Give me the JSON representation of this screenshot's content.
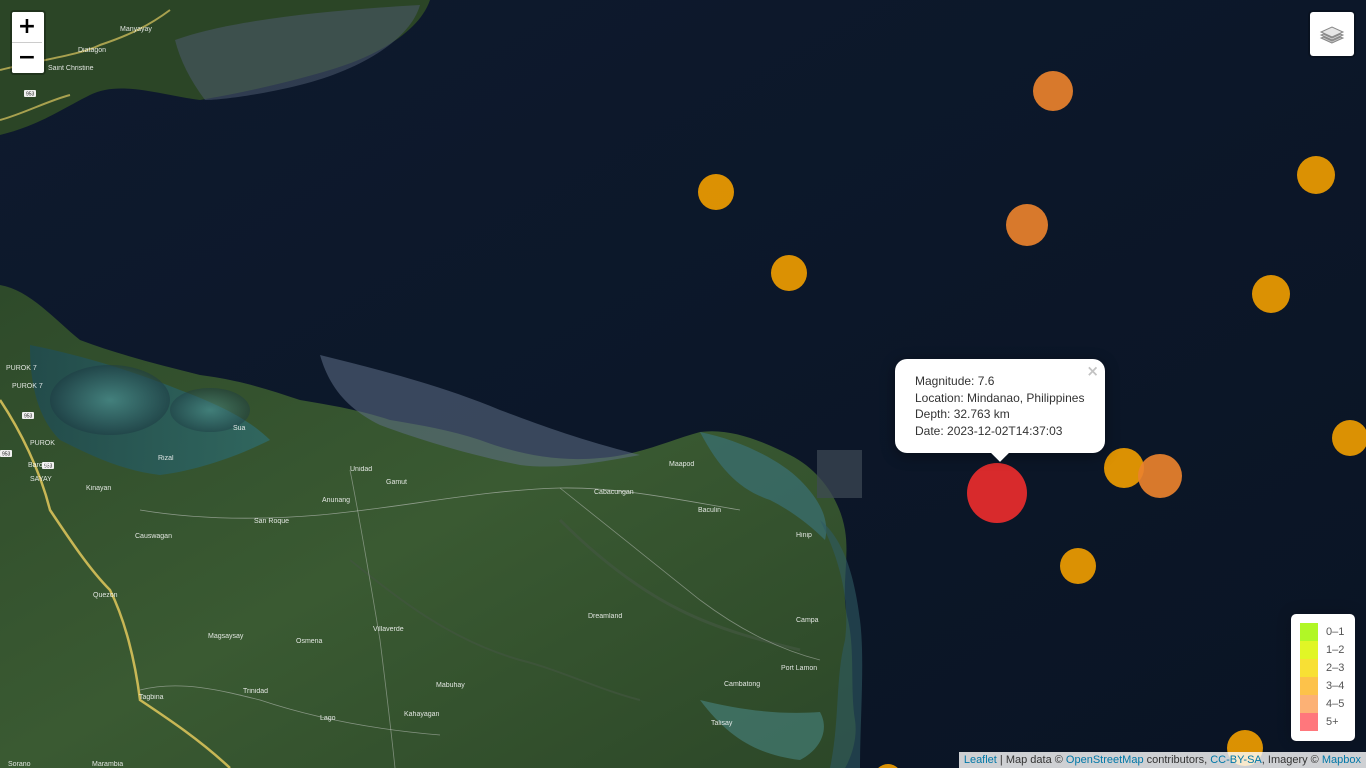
{
  "zoom": {
    "in_label": "+",
    "out_label": "−"
  },
  "layers": {
    "icon": "layers-icon"
  },
  "places": {
    "manyayay": "Manyayay",
    "diatagon": "Diatagon",
    "saint_christine": "Saint Christine",
    "barobo": "Barobo",
    "kinayan": "Kinayan",
    "rizal": "Rizal",
    "sua": "Sua",
    "unidad": "Unidad",
    "gamut": "Gamut",
    "anunang": "Anunang",
    "san_roque": "San Roque",
    "causwagan": "Causwagan",
    "cabacungan": "Cabacungan",
    "maapod": "Maapod",
    "baculin": "Baculin",
    "hinip": "Hinip",
    "quezon": "Quezon",
    "dreamland": "Dreamland",
    "villaverde": "Villaverde",
    "magsaysay": "Magsaysay",
    "osmena": "Osmena",
    "campa": "Campa",
    "port_lamon": "Port Lamon",
    "cambatong": "Cambatong",
    "tagbina": "Tagbina",
    "trinidad": "Trinidad",
    "mabuhay": "Mabuhay",
    "lago": "Lago",
    "kahayagan": "Kahayagan",
    "talisay": "Talisay",
    "sayay": "SAYAY",
    "purok7a": "PUROK 7",
    "purok7b": "PUROK 7",
    "purok": "PUROK",
    "sorano": "Sorano",
    "marambia": "Marambia"
  },
  "road_shields": [
    "953",
    "953",
    "953",
    "953"
  ],
  "earthquakes": [
    {
      "magnitude": 4.2,
      "color": "#ea822c",
      "label": "quake-1"
    },
    {
      "magnitude": 3.4,
      "color": "#ee9c00",
      "label": "quake-2"
    },
    {
      "magnitude": 4.1,
      "color": "#ea822c",
      "label": "quake-3"
    },
    {
      "magnitude": 3.3,
      "color": "#ee9c00",
      "label": "quake-4"
    },
    {
      "magnitude": 3.5,
      "color": "#ee9c00",
      "label": "quake-5"
    },
    {
      "magnitude": 3.6,
      "color": "#ee9c00",
      "label": "quake-6"
    },
    {
      "magnitude": 7.6,
      "color": "#ea2c2c",
      "label": "quake-selected"
    },
    {
      "magnitude": 3.6,
      "color": "#ee9c00",
      "label": "quake-8"
    },
    {
      "magnitude": 4.3,
      "color": "#ea822c",
      "label": "quake-9"
    },
    {
      "magnitude": 3.4,
      "color": "#ee9c00",
      "label": "quake-10"
    },
    {
      "magnitude": 3.5,
      "color": "#ee9c00",
      "label": "quake-11"
    },
    {
      "magnitude": 3.3,
      "color": "#ee9c00",
      "label": "quake-12"
    },
    {
      "magnitude": 3.2,
      "color": "#ee9c00",
      "label": "quake-13"
    }
  ],
  "popup": {
    "magnitude": "Magnitude: 7.6",
    "location": "Location: Mindanao, Philippines",
    "depth": "Depth: 32.763 km",
    "date": "Date: 2023-12-02T14:37:03",
    "close": "×"
  },
  "legend": {
    "items": [
      {
        "label": "0–1",
        "color": "#a3f600"
      },
      {
        "label": "1–2",
        "color": "#dcf400"
      },
      {
        "label": "2–3",
        "color": "#f7db11"
      },
      {
        "label": "3–4",
        "color": "#fdb72a"
      },
      {
        "label": "4–5",
        "color": "#fca35d"
      },
      {
        "label": "5+",
        "color": "#ff5f65"
      }
    ]
  },
  "attribution": {
    "leaflet": "Leaflet",
    "sep": " | Map data © ",
    "osm": "OpenStreetMap",
    "contributors": " contributors, ",
    "license": "CC-BY-SA",
    "imagery": ", Imagery © ",
    "mapbox": "Mapbox"
  }
}
